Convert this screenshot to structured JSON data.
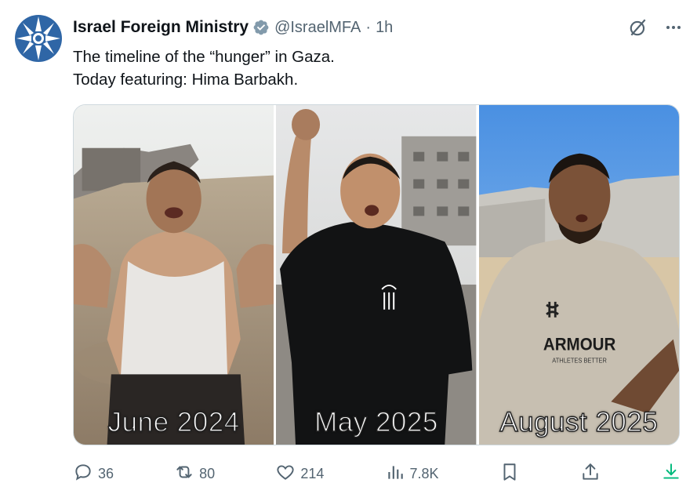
{
  "tweet": {
    "author_name": "Israel Foreign Ministry",
    "handle": "@IsraelMFA",
    "separator": "·",
    "time": "1h",
    "text_line1": "The timeline of the “hunger” in Gaza.",
    "text_line2": "Today featuring: Hima Barbakh."
  },
  "media": {
    "panels": [
      {
        "label": "June 2024"
      },
      {
        "label": "May 2025"
      },
      {
        "label": "August 2025"
      }
    ],
    "shirt_text": "ARMOUR",
    "shirt_subtext": "ATHLETES BETTER"
  },
  "actions": {
    "reply_count": "36",
    "repost_count": "80",
    "like_count": "214",
    "views_count": "7.8K"
  },
  "icons": {
    "verified": "verified-badge-icon",
    "grok": "grok-icon",
    "more": "more-icon",
    "reply": "reply-icon",
    "repost": "repost-icon",
    "like": "heart-icon",
    "views": "views-icon",
    "bookmark": "bookmark-icon",
    "share": "share-icon",
    "download": "download-icon"
  },
  "colors": {
    "text": "#0f1419",
    "secondary": "#536471",
    "verified_badge": "#829aab",
    "download_green": "#00ba7c",
    "avatar_blue": "#2f66a6"
  }
}
